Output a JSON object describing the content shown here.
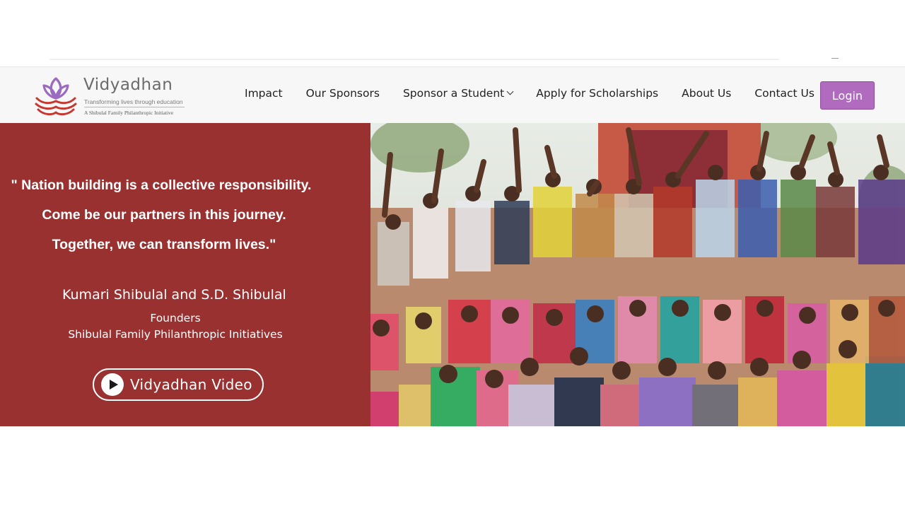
{
  "brand": {
    "name": "Vidyadhan",
    "tagline": "Transforming lives through education",
    "subline": "A Shibulal Family Philanthropic Initiative",
    "logo_colors": {
      "lotus": "#9b6bc0",
      "waves": "#c6372e"
    }
  },
  "nav": {
    "items": [
      {
        "label": "Impact"
      },
      {
        "label": "Our Sponsors"
      },
      {
        "label": "Sponsor a Student",
        "has_dropdown": true
      },
      {
        "label": "Apply for Scholarships"
      },
      {
        "label": "About Us"
      },
      {
        "label": "Contact Us"
      }
    ],
    "login_label": "Login",
    "login_color": "#b06bbf"
  },
  "hero": {
    "background_color": "#993130",
    "quote": {
      "line1": "\" Nation building is a collective responsibility.",
      "line2": "Come be our partners in this journey.",
      "line3": "Together, we can transform lives.\""
    },
    "founders_names": "Kumari Shibulal and S.D. Shibulal",
    "founders_role": "Founders",
    "founders_org": "Shibulal Family Philanthropic Initiatives",
    "video_button_label": "Vidyadhan Video",
    "photo": {
      "alt": "play-icon"
    }
  }
}
